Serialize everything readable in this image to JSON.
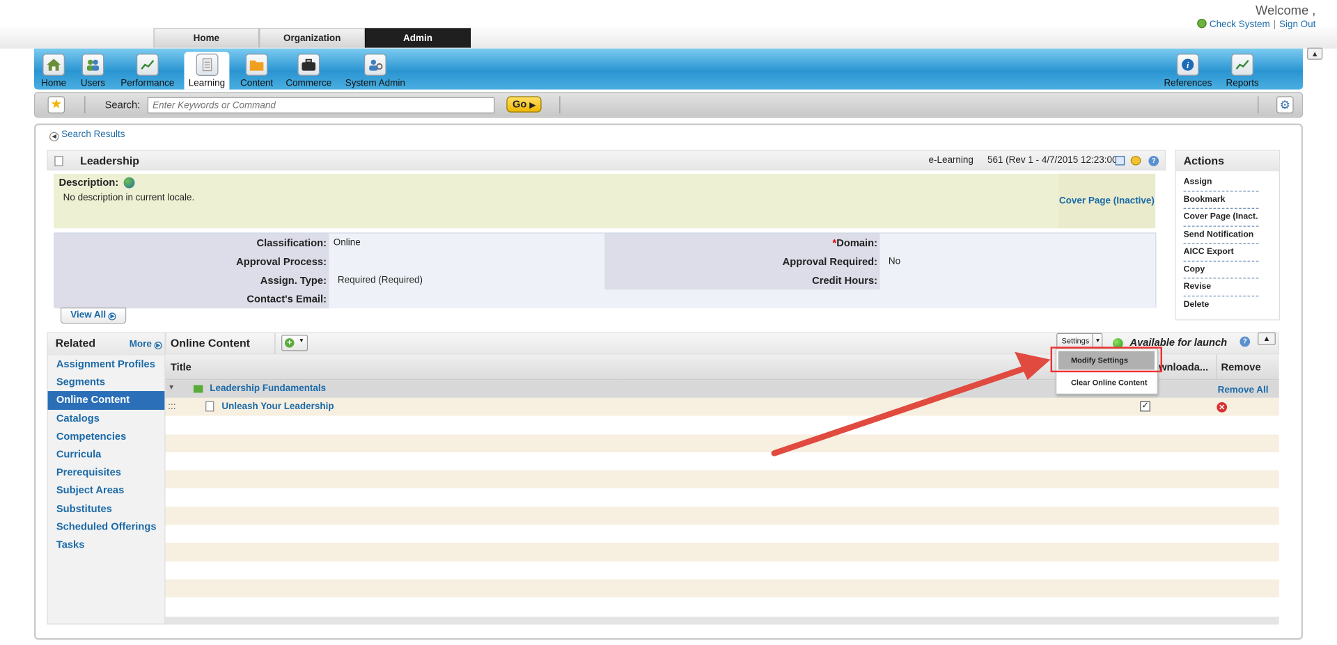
{
  "header": {
    "welcome": "Welcome ,",
    "check_system": "Check System",
    "separator": "|",
    "sign_out": "Sign Out",
    "tabs": [
      "Home",
      "Organization",
      "Admin"
    ]
  },
  "nav": {
    "items": [
      "Home",
      "Users",
      "Performance",
      "Learning",
      "Content",
      "Commerce",
      "System Admin"
    ],
    "right_items": [
      "References",
      "Reports"
    ]
  },
  "search": {
    "label": "Search:",
    "placeholder": "Enter Keywords or Command",
    "go": "Go"
  },
  "breadcrumb": "Search Results",
  "item": {
    "title": "Leadership",
    "type": "e-Learning",
    "revision": "561 (Rev 1 - 4/7/2015 12:23:00)",
    "description_label": "Description:",
    "description": "No description in current locale.",
    "cover_page": "Cover Page (Inactive)"
  },
  "fields": {
    "classification_label": "Classification:",
    "classification": "Online",
    "domain_req": "*",
    "domain_label": "Domain:",
    "approval_process_label": "Approval Process:",
    "approval_required_label": "Approval Required:",
    "approval_required": "No",
    "assign_type_label": "Assign. Type:",
    "assign_type": "Required (Required)",
    "credit_hours_label": "Credit Hours:",
    "contact_email_label": "Contact's Email:",
    "view_all": "View All"
  },
  "actions": {
    "title": "Actions",
    "items": [
      "Assign",
      "Bookmark",
      "Cover Page (Inact...",
      "Send Notification",
      "AICC Export",
      "Copy",
      "Revise",
      "Delete"
    ]
  },
  "related": {
    "title": "Related",
    "more": "More",
    "items": [
      "Assignment Profiles",
      "Segments",
      "Online Content",
      "Catalogs",
      "Competencies",
      "Curricula",
      "Prerequisites",
      "Subject Areas",
      "Substitutes",
      "Scheduled Offerings",
      "Tasks"
    ]
  },
  "content": {
    "title": "Online Content",
    "settings": "Settings",
    "status": "Available for launch",
    "col_title": "Title",
    "col_download": "wnloada...",
    "col_remove": "Remove",
    "group_name": "Leadership Fundamentals",
    "remove_all": "Remove All",
    "drag_handle": ":::",
    "row_name": "Unleash Your Leadership",
    "row_downloadable": true
  },
  "dropdown": {
    "modify": "Modify Settings",
    "clear": "Clear Online Content"
  },
  "colors": {
    "nav_blue": "#2a95d2",
    "link_blue": "#1b6aa8",
    "selected_blue": "#2a6fb8",
    "highlight_red": "#e33333"
  }
}
